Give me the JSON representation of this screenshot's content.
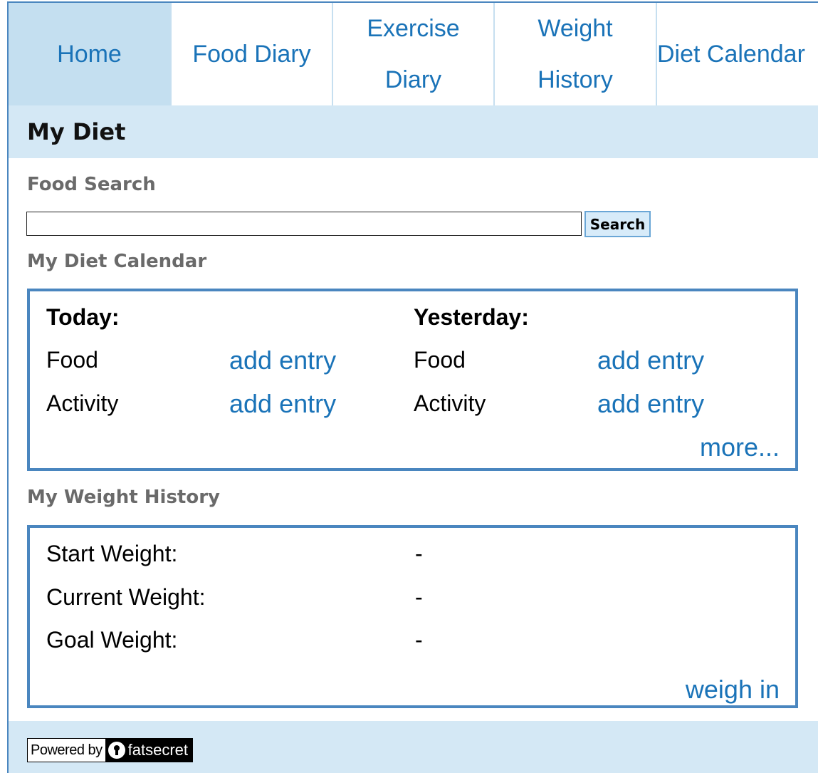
{
  "nav": {
    "items": [
      {
        "label": "Home"
      },
      {
        "label": "Food Diary"
      },
      {
        "line1": "Exercise",
        "line2": "Diary"
      },
      {
        "line1": "Weight",
        "line2": "History"
      },
      {
        "label": "Diet Calendar"
      }
    ]
  },
  "header": {
    "title": "My Diet"
  },
  "search": {
    "heading": "Food Search",
    "value": "",
    "button_label": "Search"
  },
  "calendar": {
    "heading": "My Diet Calendar",
    "today": {
      "title": "Today:",
      "food_label": "Food",
      "food_link": "add entry",
      "activity_label": "Activity",
      "activity_link": "add entry"
    },
    "yesterday": {
      "title": "Yesterday:",
      "food_label": "Food",
      "food_link": "add entry",
      "activity_label": "Activity",
      "activity_link": "add entry"
    },
    "more_link": "more..."
  },
  "weight": {
    "heading": "My Weight History",
    "rows": [
      {
        "label": "Start Weight:",
        "value": "-"
      },
      {
        "label": "Current Weight:",
        "value": "-"
      },
      {
        "label": "Goal Weight:",
        "value": "-"
      }
    ],
    "weigh_in_link": "weigh in"
  },
  "footer": {
    "powered_by": "Powered by",
    "brand": "fatsecret"
  },
  "colors": {
    "link": "#1a73b8",
    "border": "#4a86bf",
    "header_bg": "#d4e8f5",
    "active_tab_bg": "#c4dff0"
  },
  "icons": {
    "brand_logo": "keyhole-icon"
  }
}
